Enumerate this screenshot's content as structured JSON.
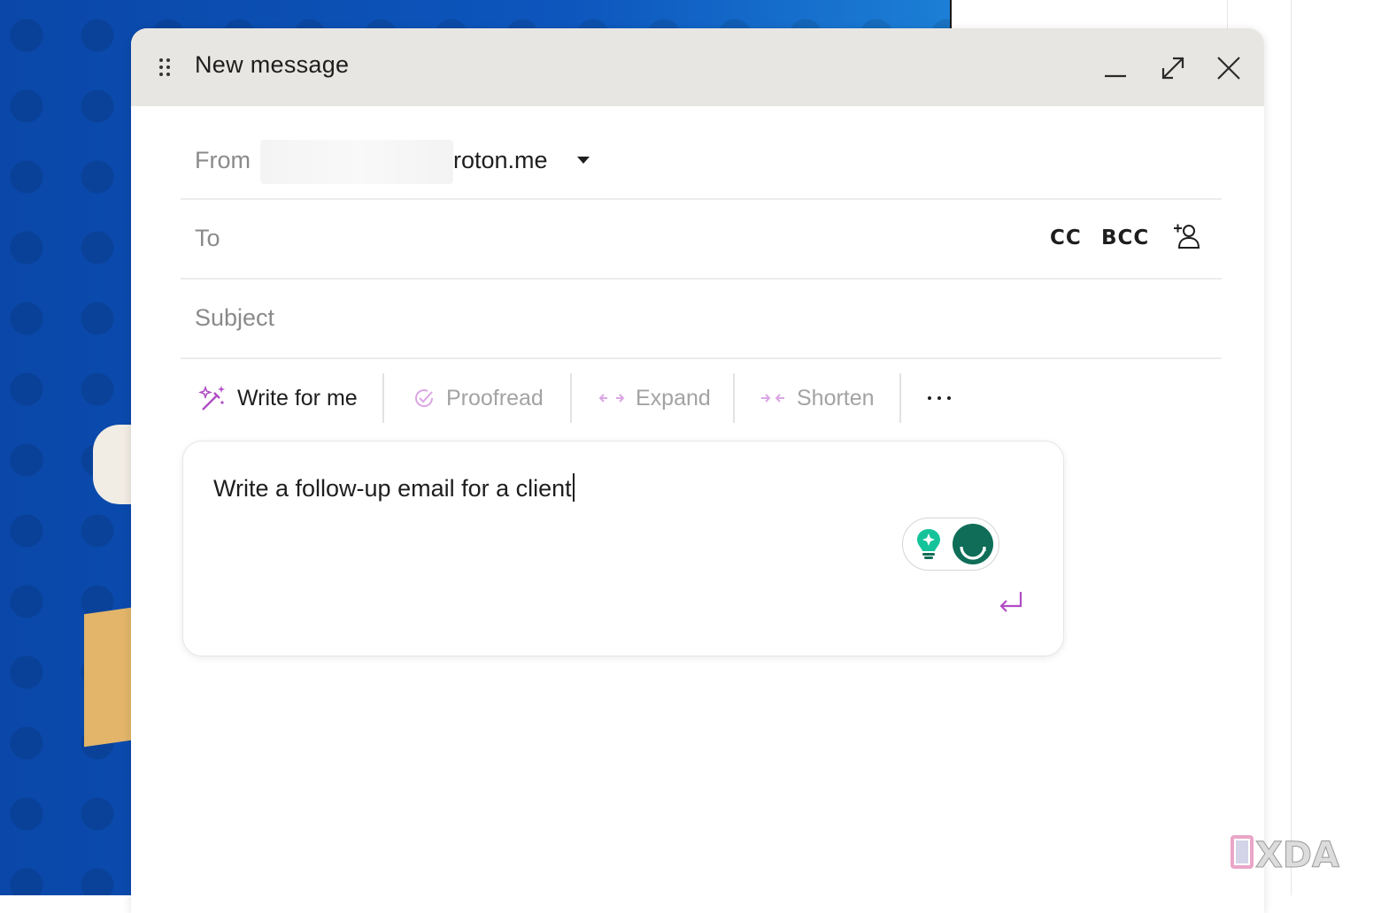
{
  "compose": {
    "title": "New message",
    "from_label": "From",
    "from_value": "roton.me",
    "to_label": "To",
    "cc_label": "CC",
    "bcc_label": "BCC",
    "subject_label": "Subject"
  },
  "assistant": {
    "tools": [
      "Write for me",
      "Proofread",
      "Expand",
      "Shorten"
    ],
    "prompt": "Write a follow-up email for a client"
  },
  "watermark": "XDA",
  "colors": {
    "accent": "#b04cc4",
    "grammarly": "#0f6d58",
    "titlebar": "#e8e6e2",
    "background_blue": "#0d56bd"
  }
}
